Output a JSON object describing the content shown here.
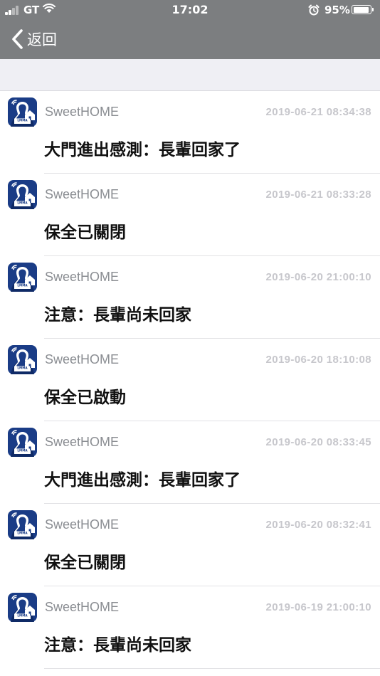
{
  "status_bar": {
    "carrier": "GT",
    "time": "17:02",
    "battery_percent": "95%",
    "battery_level": 0.95,
    "icons": [
      "signal-icon",
      "wifi-icon",
      "alarm-icon",
      "battery-icon"
    ]
  },
  "nav": {
    "back_label": "返回",
    "back_icon": "chevron-left-icon"
  },
  "colors": {
    "bar_background": "#7c7e80",
    "app_icon_background": "#1a3c86",
    "timestamp": "#c7c7cc",
    "app_name": "#8a8d92"
  },
  "notifications": [
    {
      "app": "SweetHOME",
      "time": "2019-06-21 08:34:38",
      "message": "大門進出感測：長輩回家了"
    },
    {
      "app": "SweetHOME",
      "time": "2019-06-21 08:33:28",
      "message": "保全已關閉"
    },
    {
      "app": "SweetHOME",
      "time": "2019-06-20 21:00:10",
      "message": "注意：長輩尚未回家"
    },
    {
      "app": "SweetHOME",
      "time": "2019-06-20 18:10:08",
      "message": "保全已啟動"
    },
    {
      "app": "SweetHOME",
      "time": "2019-06-20 08:33:45",
      "message": "大門進出感測：長輩回家了"
    },
    {
      "app": "SweetHOME",
      "time": "2019-06-20 08:32:41",
      "message": "保全已關閉"
    },
    {
      "app": "SweetHOME",
      "time": "2019-06-19 21:00:10",
      "message": "注意：長輩尚未回家"
    }
  ]
}
